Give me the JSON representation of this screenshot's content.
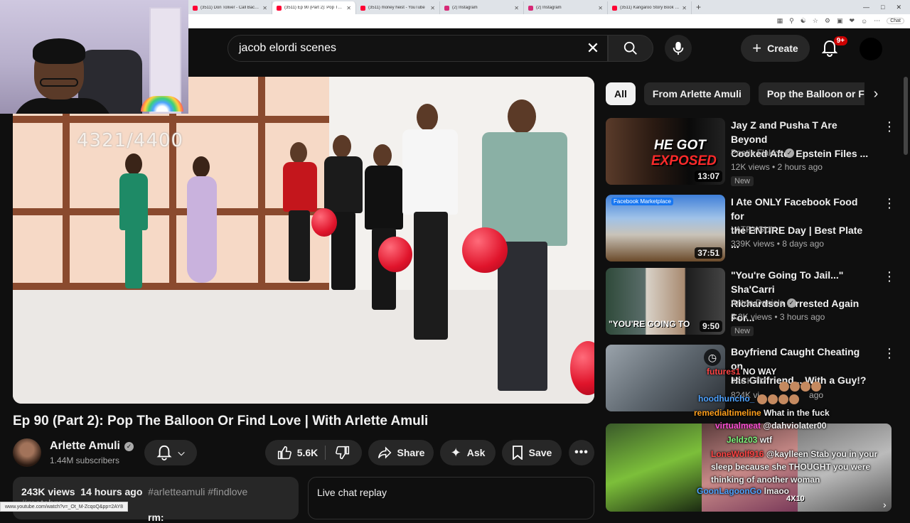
{
  "browser": {
    "tabs": [
      {
        "title": "(3511) Don Toliver - Call Back (Off",
        "color": "#ff0033",
        "active": false
      },
      {
        "title": "(3511) Ep 90 (Part 2): Pop The Ball",
        "color": "#ff0033",
        "active": true
      },
      {
        "title": "(3511) money heist - YouTube",
        "color": "#ff0033",
        "active": false
      },
      {
        "title": "(2) Instagram",
        "color": "#d62976",
        "active": false
      },
      {
        "title": "(2) Instagram",
        "color": "#d62976",
        "active": false
      },
      {
        "title": "(3511) Kangaroo Story Book 'The",
        "color": "#ff0033",
        "active": false
      }
    ],
    "new_tab": "+",
    "chat_label": "Chat",
    "status_url": "www.youtube.com/watch?v=_Ot_M-ZcqoQ&pp=2AY8"
  },
  "header": {
    "search_query": "jacob elordi scenes",
    "create_label": "Create",
    "notification_badge": "9+"
  },
  "player": {
    "overlay_counter": "4321/4400"
  },
  "video": {
    "title": "Ep 90 (Part 2): Pop The Balloon Or Find Love | With Arlette Amuli",
    "channel": "Arlette Amuli",
    "subscribers": "1.44M subscribers",
    "likes": "5.6K",
    "share_label": "Share",
    "ask_label": "Ask",
    "save_label": "Save",
    "views": "243K views",
    "age": "14 hours ago",
    "tags": "#arletteamuli #findlove #matchm",
    "desc_second_line": "rm:",
    "live_chat_label": "Live chat replay"
  },
  "chips": [
    "All",
    "From Arlette Amuli",
    "Pop the Balloon or Fin"
  ],
  "recommendations": [
    {
      "title_l1": "Jay Z and Pusha T Are Beyond",
      "title_l2": "Cooked After Epstein Files ...",
      "channel": "Poetik Flakko",
      "verified": true,
      "meta": "12K views • 2 hours ago",
      "badge": "New",
      "duration": "13:07",
      "thumb_text_1": "HE GOT",
      "thumb_text_2": "EXPOSED"
    },
    {
      "title_l1": "I Ate ONLY Facebook Food for",
      "title_l2": "the ENTIRE Day | Best Plate ...",
      "channel": "LATRYGUY",
      "verified": false,
      "meta": "339K views • 8 days ago",
      "badge": "",
      "duration": "37:51",
      "thumb_text_1": "Facebook Marketplace",
      "thumb_text_2": ""
    },
    {
      "title_l1": "\"You're Going To Jail...\" Sha'Carri",
      "title_l2": "Richardson Arrested Again For...",
      "channel": "Anton Daniels",
      "verified": true,
      "meta": "5.3K views • 3 hours ago",
      "badge": "New",
      "duration": "9:50",
      "thumb_text_1": "\"YOU'RE GOING TO",
      "thumb_text_2": ""
    },
    {
      "title_l1": "Boyfriend Caught Cheating on",
      "title_l2": "His Girlfriend... With a Guy!?",
      "channel": "JACK TV",
      "verified": false,
      "meta": "824K vi",
      "meta_tail": "ago",
      "badge": "",
      "duration": "",
      "thumb_text_1": "",
      "thumb_text_2": ""
    }
  ],
  "chat_overlay": [
    {
      "user": "futures1",
      "user_color": "#ff4444",
      "msg": "NO WAY"
    },
    {
      "user": "hoodhuncho_",
      "user_color": "#4fa3ff",
      "msg": ""
    },
    {
      "user": "remedialtimeline",
      "user_color": "#ff9f1c",
      "msg": "What in the fuck"
    },
    {
      "user": "virtualmeat",
      "user_color": "#ff4fd8",
      "msg": "@dahviolater00"
    },
    {
      "user": "Jeldz03",
      "user_color": "#7cf47c",
      "msg": "wtf"
    },
    {
      "user": "LoneWolf916",
      "user_color": "#ff4444",
      "msg": "@kaylleen Stab you in your sleep because she THOUGHT you were thinking of another woman"
    },
    {
      "user": "GoonLagoonGo",
      "user_color": "#4fa3ff",
      "msg": "lmaoo"
    }
  ],
  "rec5_badge": "4X10"
}
